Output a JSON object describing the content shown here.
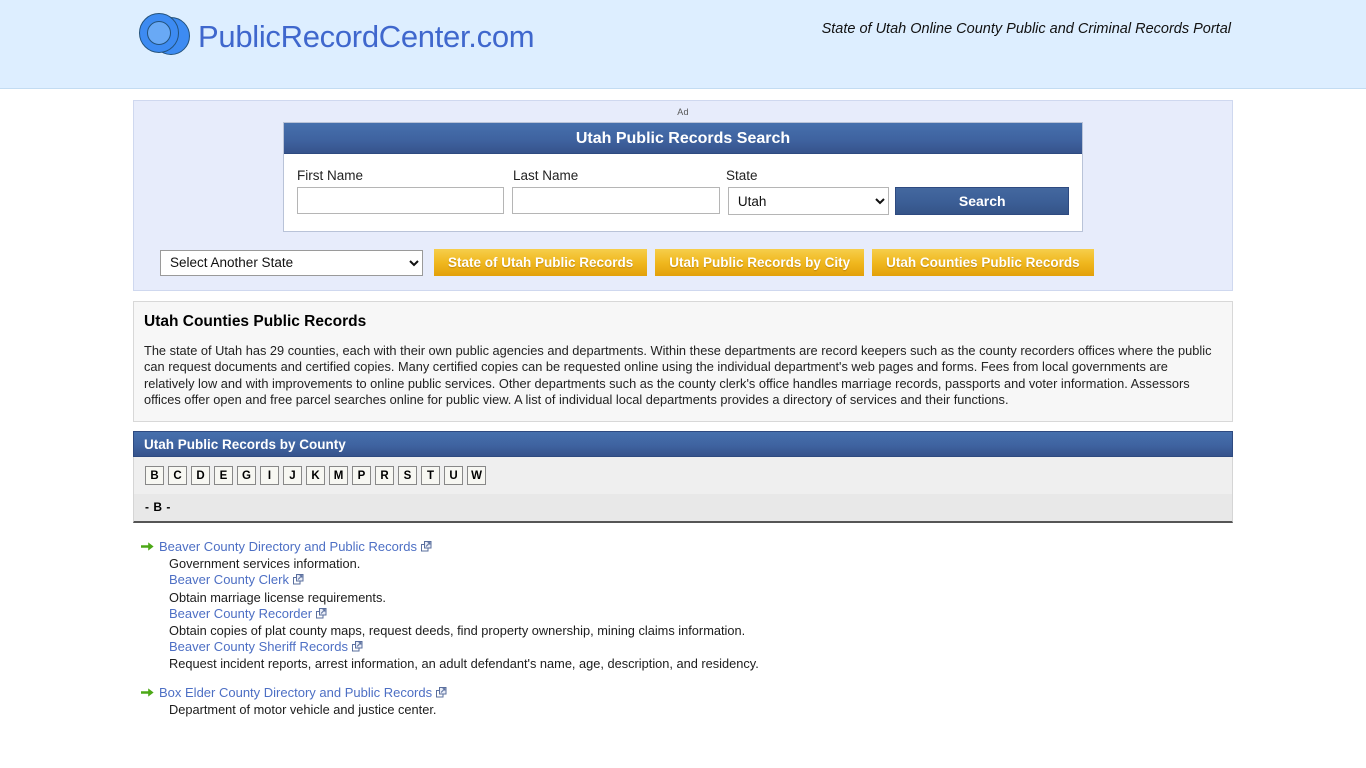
{
  "header": {
    "brand_name": "PublicRecordCenter.com",
    "logo_icon": "circles-logo-icon",
    "tagline": "State of Utah Online County Public and Criminal Records Portal"
  },
  "ad_panel": {
    "ad_label": "Ad",
    "search_card": {
      "title": "Utah Public Records Search",
      "fields": {
        "first_name_label": "First Name",
        "first_name_value": "",
        "first_name_placeholder": "",
        "last_name_label": "Last Name",
        "last_name_value": "",
        "last_name_placeholder": "",
        "state_label": "State",
        "state_value": "Utah",
        "state_options": [
          "Utah"
        ]
      },
      "search_button": "Search"
    }
  },
  "nav_row": {
    "state_select_value": "Select Another State",
    "state_select_options": [
      "Select Another State"
    ],
    "buttons": [
      {
        "label": "State of Utah Public Records"
      },
      {
        "label": "Utah Public Records by City"
      },
      {
        "label": "Utah Counties Public Records"
      }
    ]
  },
  "intro": {
    "title": "Utah Counties Public Records",
    "text": "The state of Utah has 29 counties, each with their own public agencies and departments. Within these departments are record keepers such as the county recorders offices where the public can request documents and certified copies. Many certified copies can be requested online using the individual department's web pages and forms. Fees from local governments are relatively low and with improvements to online public services. Other departments such as the county clerk's office handles marriage records, passports and voter information. Assessors offices offer open and free parcel searches online for public view. A list of individual local departments provides a directory of services and their functions."
  },
  "county_section": {
    "header": "Utah Public Records by County",
    "alphabet": [
      "B",
      "C",
      "D",
      "E",
      "G",
      "I",
      "J",
      "K",
      "M",
      "P",
      "R",
      "S",
      "T",
      "U",
      "W"
    ],
    "current_letter": "- B -",
    "groups": [
      {
        "entries": [
          {
            "link": "Beaver County Directory and Public Records",
            "desc": "Government services information."
          },
          {
            "link": "Beaver County Clerk",
            "desc": "Obtain marriage license requirements."
          },
          {
            "link": "Beaver County Recorder",
            "desc": "Obtain copies of plat county maps, request deeds, find property ownership, mining claims information."
          },
          {
            "link": "Beaver County Sheriff Records",
            "desc": "Request incident reports, arrest information, an adult defendant's name, age, description, and residency."
          }
        ]
      },
      {
        "entries": [
          {
            "link": "Box Elder County Directory and Public Records",
            "desc": "Department of motor vehicle and justice center."
          }
        ]
      }
    ]
  },
  "colors": {
    "header_bg": "#ddeeff",
    "brand_blue": "#3f67cd",
    "panel_blue": "#3f63a0",
    "gold": "#f0b81f",
    "link_blue": "#4d6fc4",
    "arrow_green": "#4ca816"
  }
}
